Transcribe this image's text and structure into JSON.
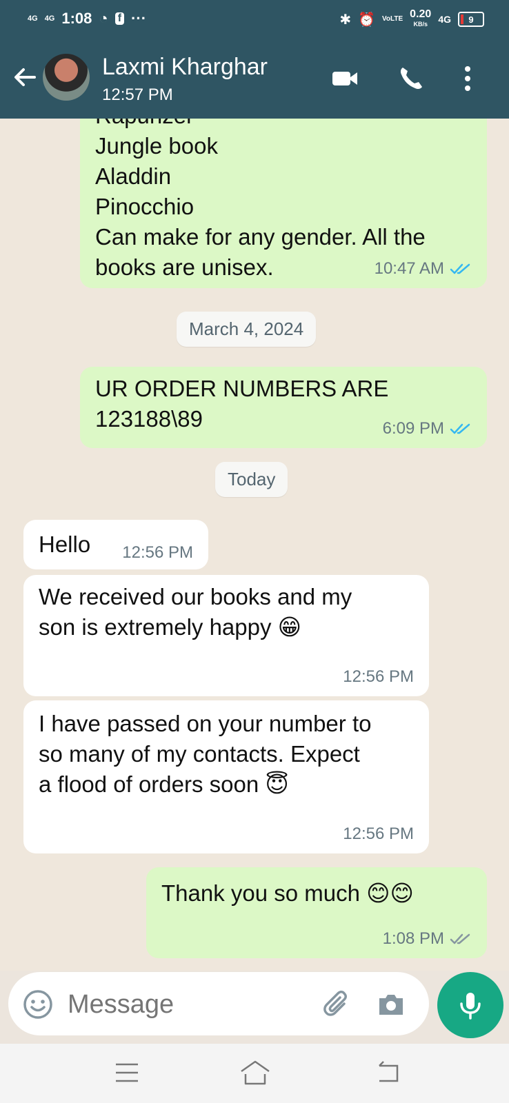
{
  "status_bar": {
    "network_left_1": "4G",
    "network_left_2": "4G",
    "time": "1:08",
    "more": "···",
    "speed_value": "0.20",
    "speed_unit": "KB/s",
    "network_right": "4G",
    "battery": "9"
  },
  "header": {
    "contact_name": "Laxmi Kharghar",
    "last_seen": "12:57 PM"
  },
  "messages": [
    {
      "direction": "out",
      "lines": [
        "Rapunzel",
        "Jungle book",
        "Aladdin",
        "Pinocchio",
        "Can make for any gender. All the",
        "books are unisex."
      ],
      "time": "10:47 AM",
      "ticks": "read"
    },
    {
      "type": "date",
      "text": "March 4, 2024"
    },
    {
      "direction": "out",
      "lines": [
        "UR ORDER NUMBERS ARE",
        "123188\\89"
      ],
      "time": "6:09 PM",
      "ticks": "read"
    },
    {
      "type": "date",
      "text": "Today"
    },
    {
      "direction": "in",
      "text": "Hello",
      "time": "12:56 PM"
    },
    {
      "direction": "in",
      "lines": [
        "We received our books and my",
        "son is extremely happy 😁"
      ],
      "time": "12:56 PM"
    },
    {
      "direction": "in",
      "lines": [
        "I have passed on your number to",
        "so many of my contacts. Expect",
        "a flood of orders soon 😇"
      ],
      "time": "12:56 PM"
    },
    {
      "direction": "out",
      "text": "Thank you so much 😊😊",
      "time": "1:08 PM",
      "ticks": "delivered"
    }
  ],
  "input": {
    "placeholder": "Message"
  },
  "colors": {
    "header": "#2f5563",
    "outgoing_bubble": "#dcf8c6",
    "incoming_bubble": "#ffffff",
    "mic_button": "#17a884",
    "read_ticks": "#34b7f1"
  },
  "icons": [
    "back-arrow-icon",
    "video-call-icon",
    "phone-call-icon",
    "more-vert-icon",
    "emoji-icon",
    "attach-icon",
    "camera-icon",
    "mic-icon",
    "menu-icon",
    "home-icon",
    "back-nav-icon"
  ]
}
